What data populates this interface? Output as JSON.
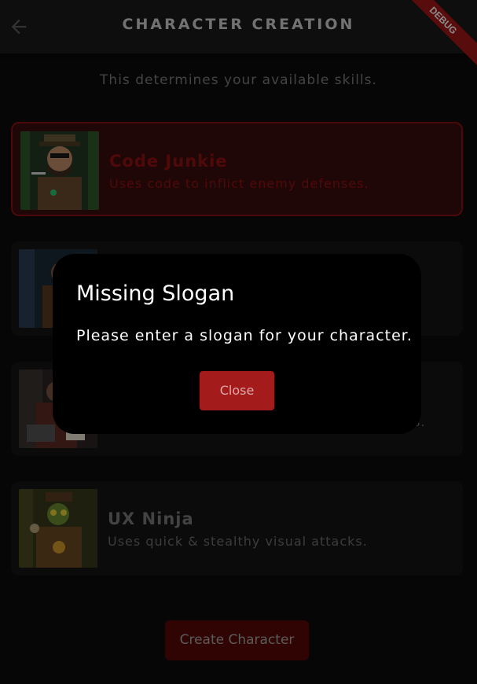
{
  "appbar": {
    "title": "CHARACTER CREATION",
    "debug_banner": "DEBUG"
  },
  "subtitle": "This determines your available skills.",
  "characters": [
    {
      "name": "Code Junkie",
      "desc": "Uses code to inflict enemy defenses.",
      "selected": true
    },
    {
      "name": "",
      "desc": "",
      "selected": false
    },
    {
      "name": "",
      "desc": "s.",
      "selected": false
    },
    {
      "name": "UX Ninja",
      "desc": "Uses quick & stealthy visual attacks.",
      "selected": false
    }
  ],
  "create_button": "Create Character",
  "dialog": {
    "title": "Missing Slogan",
    "message": "Please enter a slogan for your character.",
    "close_label": "Close"
  },
  "colors": {
    "accent": "#a41b1b",
    "selected_border": "#8b1111",
    "background": "#0b0b0b"
  }
}
